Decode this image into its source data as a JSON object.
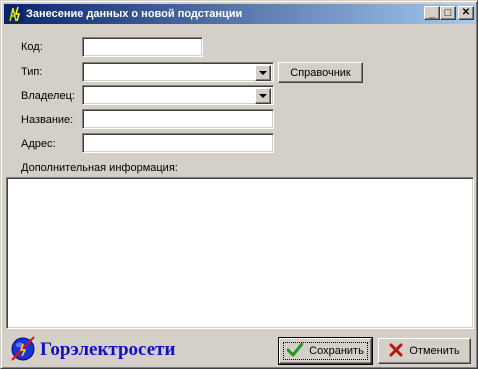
{
  "window": {
    "title": "Занесение данных о новой подстанции",
    "icon": "lightning-pylon-icon",
    "minimize_icon": "_",
    "maximize_icon": "□",
    "close_icon": "✕"
  },
  "form": {
    "code": {
      "label": "Код:",
      "value": ""
    },
    "type": {
      "label": "Тип:",
      "value": ""
    },
    "owner": {
      "label": "Владелец:",
      "value": ""
    },
    "name": {
      "label": "Название:",
      "value": ""
    },
    "address": {
      "label": "Адрес:",
      "value": ""
    },
    "lookup_button": "Справочник",
    "extra_info": {
      "label": "Дополнительная информация:",
      "value": ""
    }
  },
  "footer": {
    "brand": "Горэлектросети",
    "save_button": "Сохранить",
    "cancel_button": "Отменить"
  },
  "colors": {
    "title_gradient_start": "#0a246a",
    "title_gradient_end": "#a6caf0",
    "brand_text": "#1010c8",
    "face": "#d4d0c8"
  }
}
